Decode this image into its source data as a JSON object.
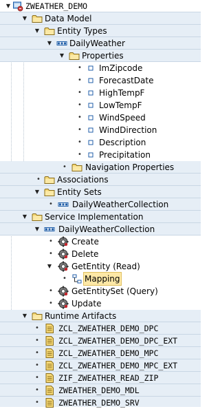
{
  "colors": {
    "row_alt": "#e6eef6",
    "selection": "#fde8a6",
    "folder": "#f5d876",
    "accent": "#1f5ea8"
  },
  "tree": {
    "root": {
      "label": "ZWEATHER_DEMO",
      "icon": "project-icon"
    },
    "data_model": {
      "label": "Data Model",
      "icon": "folder-icon"
    },
    "entity_types": {
      "label": "Entity Types",
      "icon": "folder-icon"
    },
    "daily_weather": {
      "label": "DailyWeather",
      "icon": "entity-type-icon"
    },
    "properties": {
      "label": "Properties",
      "icon": "folder-icon"
    },
    "property_items": [
      {
        "label": "ImZipcode",
        "icon": "property-icon"
      },
      {
        "label": "ForecastDate",
        "icon": "property-icon"
      },
      {
        "label": "HighTempF",
        "icon": "property-icon"
      },
      {
        "label": "LowTempF",
        "icon": "property-icon"
      },
      {
        "label": "WindSpeed",
        "icon": "property-icon"
      },
      {
        "label": "WindDirection",
        "icon": "property-icon"
      },
      {
        "label": "Description",
        "icon": "property-icon"
      },
      {
        "label": "Precipitation",
        "icon": "property-icon"
      }
    ],
    "nav_properties": {
      "label": "Navigation Properties",
      "icon": "folder-icon"
    },
    "associations": {
      "label": "Associations",
      "icon": "folder-icon"
    },
    "entity_sets": {
      "label": "Entity Sets",
      "icon": "folder-icon"
    },
    "entity_set_item": {
      "label": "DailyWeatherCollection",
      "icon": "entity-set-icon"
    },
    "service_impl": {
      "label": "Service Implementation",
      "icon": "folder-icon"
    },
    "impl_collection": {
      "label": "DailyWeatherCollection",
      "icon": "entity-set-icon"
    },
    "op_create": {
      "label": "Create",
      "icon": "operation-icon"
    },
    "op_delete": {
      "label": "Delete",
      "icon": "operation-icon"
    },
    "op_getentity": {
      "label": "GetEntity (Read)",
      "icon": "operation-icon"
    },
    "mapping": {
      "label": "Mapping",
      "icon": "mapping-icon"
    },
    "op_getentityset": {
      "label": "GetEntitySet (Query)",
      "icon": "operation-icon"
    },
    "op_update": {
      "label": "Update",
      "icon": "operation-icon"
    },
    "runtime_artifacts": {
      "label": "Runtime Artifacts",
      "icon": "folder-icon"
    },
    "artifacts": [
      {
        "label": "ZCL_ZWEATHER_DEMO_DPC",
        "icon": "class-icon"
      },
      {
        "label": "ZCL_ZWEATHER_DEMO_DPC_EXT",
        "icon": "class-icon"
      },
      {
        "label": "ZCL_ZWEATHER_DEMO_MPC",
        "icon": "class-icon"
      },
      {
        "label": "ZCL_ZWEATHER_DEMO_MPC_EXT",
        "icon": "class-icon"
      },
      {
        "label": "ZIF_ZWEATHER_READ_ZIP",
        "icon": "interface-icon"
      },
      {
        "label": "ZWEATHER_DEMO_MDL",
        "icon": "model-icon"
      },
      {
        "label": "ZWEATHER_DEMO_SRV",
        "icon": "service-icon"
      }
    ]
  }
}
